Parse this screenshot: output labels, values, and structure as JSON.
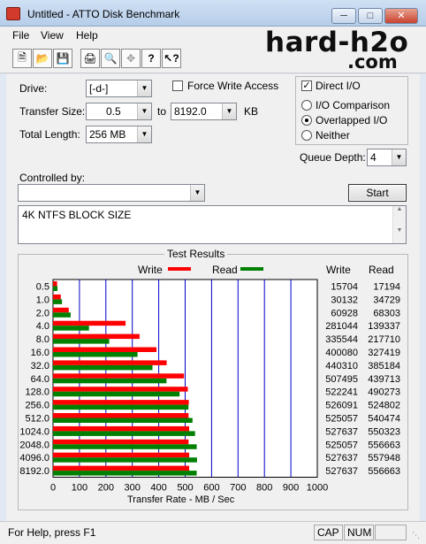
{
  "window": {
    "title": "Untitled - ATTO Disk Benchmark"
  },
  "menu": [
    "File",
    "View",
    "Help"
  ],
  "toolbar": {
    "icons": [
      "new-icon",
      "open-icon",
      "save-icon",
      "print-icon",
      "print-preview-icon",
      "move-icon",
      "help-icon",
      "context-help-icon"
    ]
  },
  "logo": {
    "line1": "hard-h2o",
    "line2": ".com"
  },
  "form": {
    "drive_label": "Drive:",
    "drive_value": "[-d-]",
    "force_write_label": "Force Write Access",
    "force_write_checked": false,
    "direct_io_label": "Direct I/O",
    "direct_io_checked": true,
    "transfer_size_label": "Transfer Size:",
    "transfer_from": "0.5",
    "to_label": "to",
    "transfer_to": "8192.0",
    "unit_label": "KB",
    "io_comparison_label": "I/O Comparison",
    "overlapped_label": "Overlapped I/O",
    "neither_label": "Neither",
    "selected_mode": "Overlapped I/O",
    "total_length_label": "Total Length:",
    "total_length_value": "256 MB",
    "queue_depth_label": "Queue Depth:",
    "queue_depth_value": "4",
    "controlled_by_label": "Controlled by:",
    "controlled_by_value": "",
    "start_label": "Start",
    "description": "4K NTFS BLOCK SIZE"
  },
  "results": {
    "title": "Test Results",
    "write_label": "Write",
    "read_label": "Read",
    "write_col_header": "Write",
    "read_col_header": "Read",
    "xlabel": "Transfer Rate - MB / Sec",
    "write_color": "#ff0000",
    "read_color": "#008000",
    "grid_color": "#0000c8"
  },
  "chart_data": {
    "type": "bar",
    "orientation": "horizontal",
    "xlabel": "Transfer Rate - MB / Sec",
    "xlim": [
      0,
      1000
    ],
    "xticks": [
      "0",
      "100",
      "200",
      "300",
      "400",
      "500",
      "600",
      "700",
      "800",
      "900",
      "1000"
    ],
    "categories": [
      "0.5",
      "1.0",
      "2.0",
      "4.0",
      "8.0",
      "16.0",
      "32.0",
      "64.0",
      "128.0",
      "256.0",
      "512.0",
      "1024.0",
      "2048.0",
      "4096.0",
      "8192.0"
    ],
    "series": [
      {
        "name": "Write",
        "values": [
          15.3,
          29.4,
          59.5,
          274.5,
          327.5,
          391.5,
          430.0,
          495.6,
          510.0,
          513.8,
          512.8,
          515.3,
          512.8,
          515.3,
          515.3
        ]
      },
      {
        "name": "Read",
        "values": [
          16.8,
          33.9,
          66.7,
          136.1,
          212.6,
          319.7,
          376.3,
          429.4,
          478.8,
          512.5,
          527.8,
          537.4,
          543.6,
          544.9,
          543.6
        ]
      }
    ],
    "write_table": [
      "15704",
      "30132",
      "60928",
      "281044",
      "335544",
      "400080",
      "440310",
      "507495",
      "522241",
      "526091",
      "525057",
      "527637",
      "525057",
      "527637",
      "527637"
    ],
    "read_table": [
      "17194",
      "34729",
      "68303",
      "139337",
      "217710",
      "327419",
      "385184",
      "439713",
      "490273",
      "524802",
      "540474",
      "550323",
      "556663",
      "557948",
      "556663"
    ],
    "legend": "top"
  },
  "status": {
    "help_text": "For Help, press F1",
    "cap": "CAP",
    "num": "NUM",
    "extra": ""
  }
}
